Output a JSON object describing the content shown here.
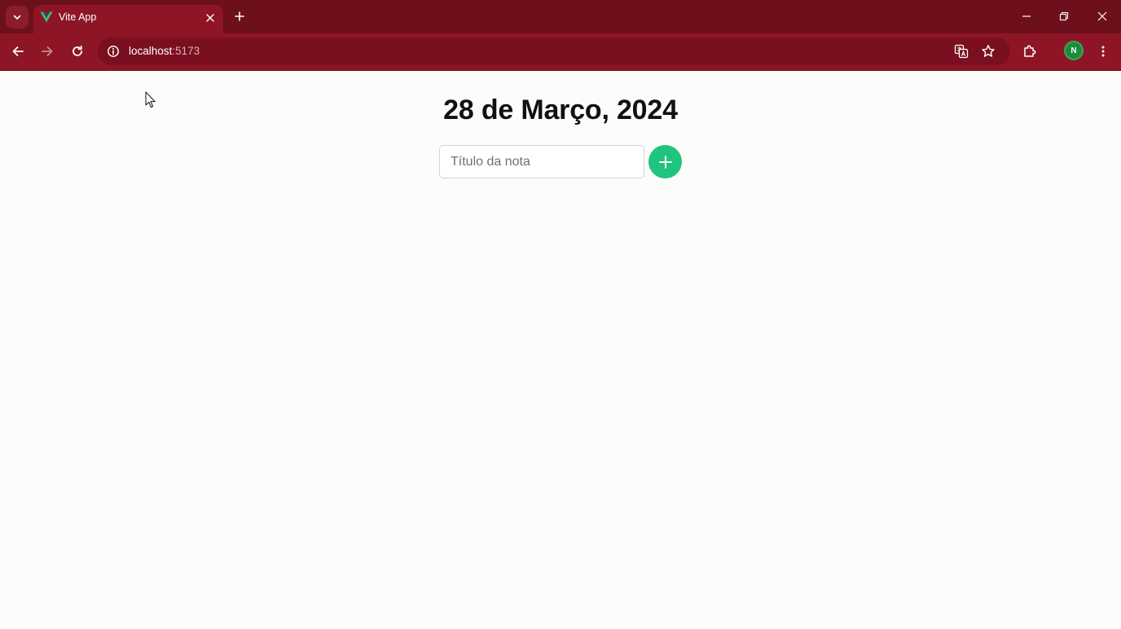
{
  "browser": {
    "tab": {
      "title": "Vite App",
      "favicon": "vue-logo-icon"
    },
    "address": {
      "host": "localhost",
      "port": ":5173"
    },
    "profile_initial": "N",
    "colors": {
      "tabstrip": "#6e0f1c",
      "toolbar": "#8e1526"
    }
  },
  "page": {
    "title": "28 de Março, 2024",
    "note_input": {
      "placeholder": "Título da nota",
      "value": ""
    },
    "add_button_icon": "plus-icon",
    "colors": {
      "accent": "#1fc57c",
      "background": "#fcfcfb"
    }
  }
}
